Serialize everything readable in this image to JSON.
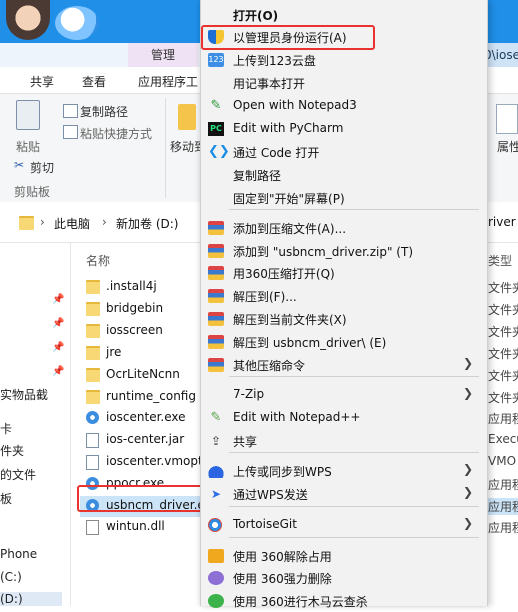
{
  "explorer": {
    "ribbon_tabs": [
      "共享",
      "查看",
      "应用程序工"
    ],
    "manage_tab": "管理",
    "title_fragment": "0\\iose",
    "clipboard": {
      "pin_label": "粘贴",
      "copy_path": "复制路径",
      "paste_shortcut": "粘贴快捷方式",
      "cut": "剪切",
      "group_label": "剪贴板",
      "move_to": "移动到",
      "properties": "属性"
    },
    "breadcrumb": [
      "此电脑",
      "新加卷 (D:)"
    ],
    "address_right": "river",
    "columns": {
      "name": "名称",
      "type": "类型"
    },
    "nav_items": [
      "实物品截",
      "卡",
      "件夹",
      "的文件",
      "板",
      "Phone",
      "(C:)",
      "(D:)"
    ],
    "files": [
      {
        "name": ".install4j",
        "kind": "folder"
      },
      {
        "name": "bridgebin",
        "kind": "folder"
      },
      {
        "name": "iosscreen",
        "kind": "folder"
      },
      {
        "name": "jre",
        "kind": "folder"
      },
      {
        "name": "OcrLiteNcnn",
        "kind": "folder"
      },
      {
        "name": "runtime_config",
        "kind": "folder"
      },
      {
        "name": "ioscenter.exe",
        "kind": "exe"
      },
      {
        "name": "ios-center.jar",
        "kind": "doc"
      },
      {
        "name": "ioscenter.vmopt",
        "kind": "doc"
      },
      {
        "name": "ppocr.exe",
        "kind": "exe"
      },
      {
        "name": "usbncm_driver.e",
        "kind": "exe",
        "selected": true
      },
      {
        "name": "wintun.dll",
        "kind": "dll"
      }
    ],
    "types": [
      "文件夹",
      "文件夹",
      "文件夹",
      "文件夹",
      "文件夹",
      "文件夹",
      "应用程",
      "Execu",
      "VMO",
      "应用程",
      "应用程",
      "应用程"
    ]
  },
  "context_menu": {
    "items": [
      {
        "label": "打开(O)",
        "bold": true,
        "icon": "none"
      },
      {
        "label": "以管理员身份运行(A)",
        "icon": "shield-icon",
        "highlighted": true
      },
      {
        "label": "上传到123云盘",
        "icon": "cloud-123-icon",
        "icon_text": "123"
      },
      {
        "label": "用记事本打开",
        "icon": "none"
      },
      {
        "label": "Open with Notepad3",
        "icon": "notepad3-icon",
        "icon_text": "✎"
      },
      {
        "label": "Edit with PyCharm",
        "icon": "pycharm-icon",
        "icon_text": "PC"
      },
      {
        "label": "通过 Code 打开",
        "icon": "vscode-icon",
        "icon_text": "❮❯"
      },
      {
        "label": "复制路径",
        "icon": "none"
      },
      {
        "label": "固定到\"开始\"屏幕(P)",
        "icon": "none"
      },
      {
        "label": "添加到压缩文件(A)...",
        "icon": "archive-icon"
      },
      {
        "label": "添加到 \"usbncm_driver.zip\" (T)",
        "icon": "archive-icon"
      },
      {
        "label": "用360压缩打开(Q)",
        "icon": "archive-icon"
      },
      {
        "label": "解压到(F)...",
        "icon": "archive-icon"
      },
      {
        "label": "解压到当前文件夹(X)",
        "icon": "archive-icon"
      },
      {
        "label": "解压到 usbncm_driver\\ (E)",
        "icon": "archive-icon"
      },
      {
        "label": "其他压缩命令",
        "icon": "archive-icon",
        "submenu": true
      },
      {
        "label": "7-Zip",
        "icon": "none",
        "submenu": true
      },
      {
        "label": "Edit with Notepad++",
        "icon": "notepadpp-icon",
        "icon_text": "✎"
      },
      {
        "label": "共享",
        "icon": "share-icon",
        "icon_text": "⇪"
      },
      {
        "label": "上传或同步到WPS",
        "icon": "wps-cloud-icon",
        "submenu": true
      },
      {
        "label": "通过WPS发送",
        "icon": "send-icon",
        "icon_text": "➤",
        "submenu": true
      },
      {
        "label": "TortoiseGit",
        "icon": "tortoisegit-icon",
        "submenu": true
      },
      {
        "label": "使用 360解除占用",
        "icon": "unlock-360-icon"
      },
      {
        "label": "使用 360强力删除",
        "icon": "delete-360-icon"
      },
      {
        "label": "使用 360进行木马云查杀",
        "icon": "scan-360-icon"
      }
    ]
  }
}
